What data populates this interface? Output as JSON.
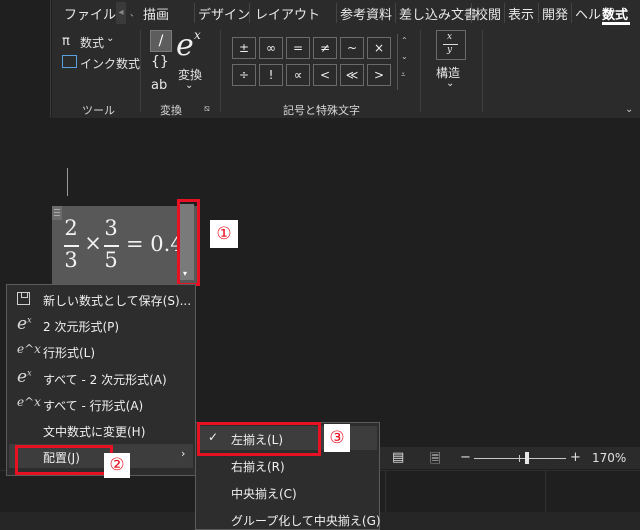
{
  "ribbon": {
    "tabs": [
      "ファイル",
      "描画",
      "デザイン",
      "レイアウト",
      "参考資料",
      "差し込み文書",
      "校閲",
      "表示",
      "開発",
      "ヘルプ",
      "数式"
    ],
    "active_tab": "数式",
    "tools": {
      "equation": "数式",
      "ink_equation": "インク数式",
      "group": "ツール"
    },
    "convert": {
      "linear": "/",
      "braces": "{}",
      "text": "ab",
      "convert_label": "変換",
      "group": "変換"
    },
    "symbols": {
      "row1": [
        "±",
        "∞",
        "=",
        "≠",
        "~",
        "×"
      ],
      "row2": [
        "÷",
        "!",
        "∝",
        "<",
        "≪",
        ">"
      ],
      "group": "記号と特殊文字"
    },
    "structures": {
      "label": "構造"
    }
  },
  "equation": {
    "num1": "2",
    "den1": "3",
    "times": "×",
    "num2": "3",
    "den2": "5",
    "rest": "= 0.4"
  },
  "callouts": {
    "one": "①",
    "two": "②",
    "three": "③"
  },
  "context_menu": {
    "items": [
      {
        "icon": "save-icon",
        "label": "新しい数式として保存(S)..."
      },
      {
        "icon": "professional-format-icon",
        "label": "2 次元形式(P)"
      },
      {
        "icon": "linear-format-icon",
        "label": "行形式(L)"
      },
      {
        "icon": "professional-format-icon",
        "label": "すべて - 2 次元形式(A)"
      },
      {
        "icon": "linear-format-icon",
        "label": "すべて - 行形式(A)"
      },
      {
        "icon": "",
        "label": "文中数式に変更(H)"
      },
      {
        "icon": "",
        "label": "配置(J)"
      }
    ]
  },
  "submenu": {
    "items": [
      {
        "checked": true,
        "label": "左揃え(L)"
      },
      {
        "checked": false,
        "label": "右揃え(R)"
      },
      {
        "checked": false,
        "label": "中央揃え(C)"
      },
      {
        "checked": false,
        "label": "グループ化して中央揃え(G)"
      }
    ]
  },
  "statusbar": {
    "minus": "−",
    "plus": "+",
    "zoom": "170%",
    "zoom_fraction": 0.58
  }
}
